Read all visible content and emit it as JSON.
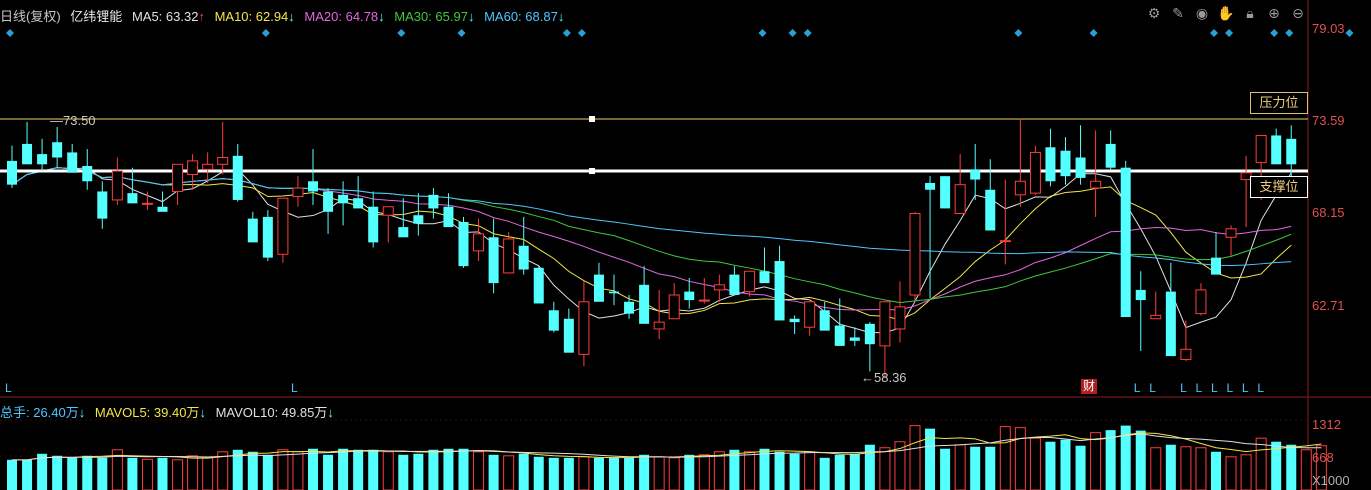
{
  "header": {
    "period": "日线(复权)",
    "stock_name": "亿纬锂能",
    "ma5": {
      "label": "MA5: 63.32",
      "arrow": "↑",
      "color": "#e0e0e0"
    },
    "ma10": {
      "label": "MA10: 62.94",
      "arrow": "↓",
      "color": "#f2e64b"
    },
    "ma20": {
      "label": "MA20: 64.78",
      "arrow": "↓",
      "color": "#e068e0"
    },
    "ma30": {
      "label": "MA30: 65.97",
      "arrow": "↓",
      "color": "#3fc83f"
    },
    "ma60": {
      "label": "MA60: 68.87",
      "arrow": "↓",
      "color": "#4fc6ff"
    }
  },
  "toolbar": {
    "icons": [
      "gear-icon",
      "draw-icon",
      "eye-icon",
      "hand-icon",
      "lock-icon",
      "zoom-in-icon",
      "zoom-out-icon"
    ]
  },
  "price_axis": {
    "ticks": [
      "79.03",
      "73.59",
      "68.15",
      "62.71"
    ]
  },
  "annotations": {
    "high_marker": "73.50",
    "low_marker": "58.36",
    "resistance": "压力位",
    "support": "支撑位",
    "caicai": "财",
    "l_marker": "L"
  },
  "volume_header": {
    "total": {
      "label": "总手: 26.40万",
      "arrow": "↓",
      "color": "#4fc6ff"
    },
    "mavol5": {
      "label": "MAVOL5: 39.40万",
      "arrow": "↓",
      "color": "#f2e64b"
    },
    "mavol10": {
      "label": "MAVOL10: 49.85万",
      "arrow": "↓",
      "color": "#e0e0e0"
    }
  },
  "volume_axis": {
    "ticks": [
      "1312",
      "668"
    ],
    "unit": "X1000"
  },
  "colors": {
    "up": "#ff3c3c",
    "down": "#54ffff",
    "resistance_line": "#e8d46a",
    "support_line": "#ffffff",
    "background": "#000000"
  },
  "chart_data": {
    "type": "candlestick",
    "ylim": [
      58.36,
      79.03
    ],
    "ma_values": {
      "MA5": 63.32,
      "MA10": 62.94,
      "MA20": 64.78,
      "MA30": 65.97,
      "MA60": 68.87
    },
    "resistance_level": 73.5,
    "candles": [
      [
        71.2,
        72.1,
        69.6,
        69.8
      ],
      [
        72.2,
        73.5,
        71.5,
        71.0
      ],
      [
        71.6,
        72.5,
        70.6,
        71.0
      ],
      [
        72.3,
        73.2,
        70.8,
        71.4
      ],
      [
        71.7,
        72.2,
        71.1,
        70.5
      ],
      [
        70.9,
        71.9,
        69.5,
        70.0
      ],
      [
        69.4,
        70.0,
        67.2,
        67.8
      ],
      [
        68.9,
        71.4,
        68.6,
        70.6
      ],
      [
        69.3,
        70.8,
        68.7,
        68.7
      ],
      [
        68.7,
        69.4,
        68.3,
        68.7
      ],
      [
        68.5,
        69.4,
        68.5,
        68.2
      ],
      [
        69.4,
        70.8,
        68.6,
        71.0
      ],
      [
        70.4,
        71.6,
        69.5,
        71.2
      ],
      [
        70.7,
        71.7,
        69.9,
        71.0
      ],
      [
        71.0,
        73.5,
        70.4,
        71.4
      ],
      [
        71.5,
        72.2,
        68.8,
        68.9
      ],
      [
        67.8,
        68.2,
        66.4,
        66.4
      ],
      [
        67.9,
        68.3,
        65.3,
        65.5
      ],
      [
        65.7,
        69.0,
        65.2,
        69.0
      ],
      [
        69.1,
        70.3,
        68.5,
        69.6
      ],
      [
        70.0,
        71.9,
        68.6,
        69.4
      ],
      [
        69.4,
        69.6,
        66.9,
        68.2
      ],
      [
        69.2,
        70.0,
        67.4,
        68.7
      ],
      [
        69.0,
        70.3,
        68.5,
        68.4
      ],
      [
        68.5,
        69.4,
        66.1,
        66.4
      ],
      [
        68.0,
        68.5,
        66.4,
        68.5
      ],
      [
        67.3,
        69.0,
        66.8,
        66.7
      ],
      [
        68.0,
        69.3,
        66.8,
        67.5
      ],
      [
        69.2,
        69.6,
        67.8,
        68.4
      ],
      [
        68.5,
        69.3,
        67.6,
        67.3
      ],
      [
        67.6,
        67.9,
        64.9,
        65.0
      ],
      [
        65.9,
        67.8,
        65.3,
        66.9
      ],
      [
        66.7,
        67.8,
        63.4,
        64.0
      ],
      [
        64.6,
        67.0,
        64.6,
        66.6
      ],
      [
        66.2,
        67.9,
        64.5,
        64.8
      ],
      [
        64.9,
        65.0,
        63.1,
        62.8
      ],
      [
        62.4,
        62.9,
        61.1,
        61.2
      ],
      [
        61.9,
        62.5,
        60.1,
        59.9
      ],
      [
        59.8,
        64.1,
        59.1,
        62.9
      ],
      [
        64.5,
        65.2,
        63.0,
        62.9
      ],
      [
        63.5,
        64.5,
        62.7,
        63.4
      ],
      [
        62.9,
        63.3,
        61.9,
        62.2
      ],
      [
        63.9,
        65.0,
        62.1,
        61.6
      ],
      [
        61.3,
        63.6,
        60.7,
        61.7
      ],
      [
        61.9,
        64.0,
        61.9,
        63.3
      ],
      [
        63.5,
        64.3,
        62.5,
        63.0
      ],
      [
        63.0,
        64.3,
        62.8,
        63.0
      ],
      [
        63.6,
        64.5,
        62.9,
        63.9
      ],
      [
        64.5,
        65.0,
        63.5,
        63.3
      ],
      [
        63.5,
        64.7,
        63.2,
        64.7
      ],
      [
        64.7,
        66.1,
        64.2,
        64.0
      ],
      [
        65.3,
        66.2,
        62.6,
        61.8
      ],
      [
        61.9,
        62.1,
        61.0,
        61.7
      ],
      [
        61.4,
        62.0,
        60.9,
        62.9
      ],
      [
        62.4,
        62.9,
        61.3,
        61.2
      ],
      [
        61.5,
        63.1,
        60.9,
        60.3
      ],
      [
        60.8,
        61.4,
        60.3,
        60.6
      ],
      [
        61.6,
        61.7,
        58.8,
        60.4
      ],
      [
        60.3,
        62.1,
        58.4,
        62.9
      ],
      [
        61.3,
        64.1,
        60.5,
        62.6
      ],
      [
        63.3,
        68.2,
        62.9,
        68.1
      ],
      [
        69.9,
        70.3,
        63.1,
        69.5
      ],
      [
        70.3,
        70.3,
        68.4,
        68.4
      ],
      [
        68.1,
        71.6,
        68.1,
        69.8
      ],
      [
        70.7,
        72.2,
        68.9,
        70.1
      ],
      [
        69.5,
        71.3,
        67.6,
        67.1
      ],
      [
        66.5,
        70.1,
        65.1,
        66.5
      ],
      [
        69.2,
        73.7,
        68.5,
        70.0
      ],
      [
        69.3,
        72.1,
        69.2,
        71.7
      ],
      [
        72.0,
        73.1,
        69.7,
        70.0
      ],
      [
        71.8,
        72.6,
        69.8,
        70.3
      ],
      [
        71.4,
        73.3,
        69.8,
        70.2
      ],
      [
        69.6,
        73.0,
        67.9,
        70.0
      ],
      [
        72.2,
        73.0,
        70.7,
        70.8
      ],
      [
        70.8,
        71.2,
        68.6,
        62.0
      ],
      [
        63.6,
        64.7,
        60.0,
        63.0
      ],
      [
        61.9,
        63.5,
        62.0,
        62.1
      ],
      [
        63.5,
        65.2,
        62.8,
        59.7
      ],
      [
        59.5,
        61.8,
        59.4,
        60.1
      ],
      [
        62.2,
        64.0,
        62.1,
        63.6
      ],
      [
        65.5,
        67.0,
        64.9,
        64.5
      ],
      [
        66.7,
        67.4,
        65.6,
        67.2
      ],
      [
        70.1,
        71.5,
        67.3,
        70.5
      ],
      [
        71.1,
        72.1,
        68.9,
        72.7
      ],
      [
        72.7,
        73.1,
        71.7,
        71.0
      ],
      [
        72.5,
        73.3,
        70.3,
        71.0
      ]
    ],
    "volume_ylim": [
      0,
      1312
    ],
    "volumes": [
      600,
      600,
      720,
      680,
      640,
      680,
      640,
      800,
      640,
      610,
      640,
      600,
      680,
      640,
      760,
      800,
      760,
      700,
      800,
      760,
      820,
      700,
      820,
      800,
      800,
      760,
      700,
      720,
      800,
      820,
      820,
      760,
      700,
      680,
      720,
      660,
      640,
      640,
      660,
      640,
      640,
      640,
      700,
      660,
      640,
      700,
      700,
      760,
      800,
      760,
      820,
      760,
      720,
      760,
      640,
      700,
      720,
      900,
      840,
      960,
      1280,
      1220,
      820,
      900,
      860,
      860,
      1260,
      1240,
      1030,
      960,
      1000,
      880,
      1140,
      1190,
      1280,
      1180,
      840,
      900,
      860,
      840,
      760,
      660,
      700,
      1030,
      960,
      900,
      800,
      880
    ]
  }
}
